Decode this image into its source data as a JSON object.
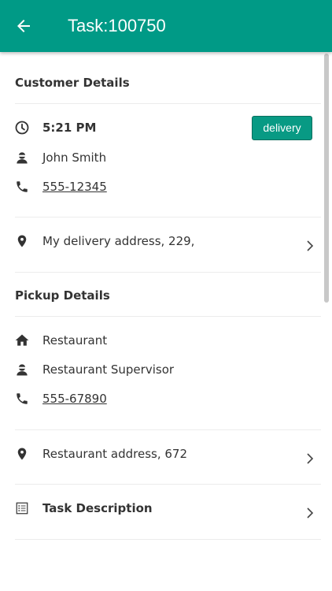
{
  "appbar": {
    "title": "Task:100750",
    "back_icon": "arrow-left-icon"
  },
  "customer": {
    "heading": "Customer Details",
    "time": "5:21 PM",
    "badge": "delivery",
    "name": "John Smith",
    "phone": "555-12345",
    "address": "My delivery address, 229,"
  },
  "pickup": {
    "heading": "Pickup Details",
    "place": "Restaurant",
    "contact": "Restaurant Supervisor",
    "phone": "555-67890",
    "address": "Restaurant address, 672"
  },
  "task": {
    "description_label": "Task Description"
  },
  "colors": {
    "primary": "#009a86",
    "badge": "#089a84"
  }
}
